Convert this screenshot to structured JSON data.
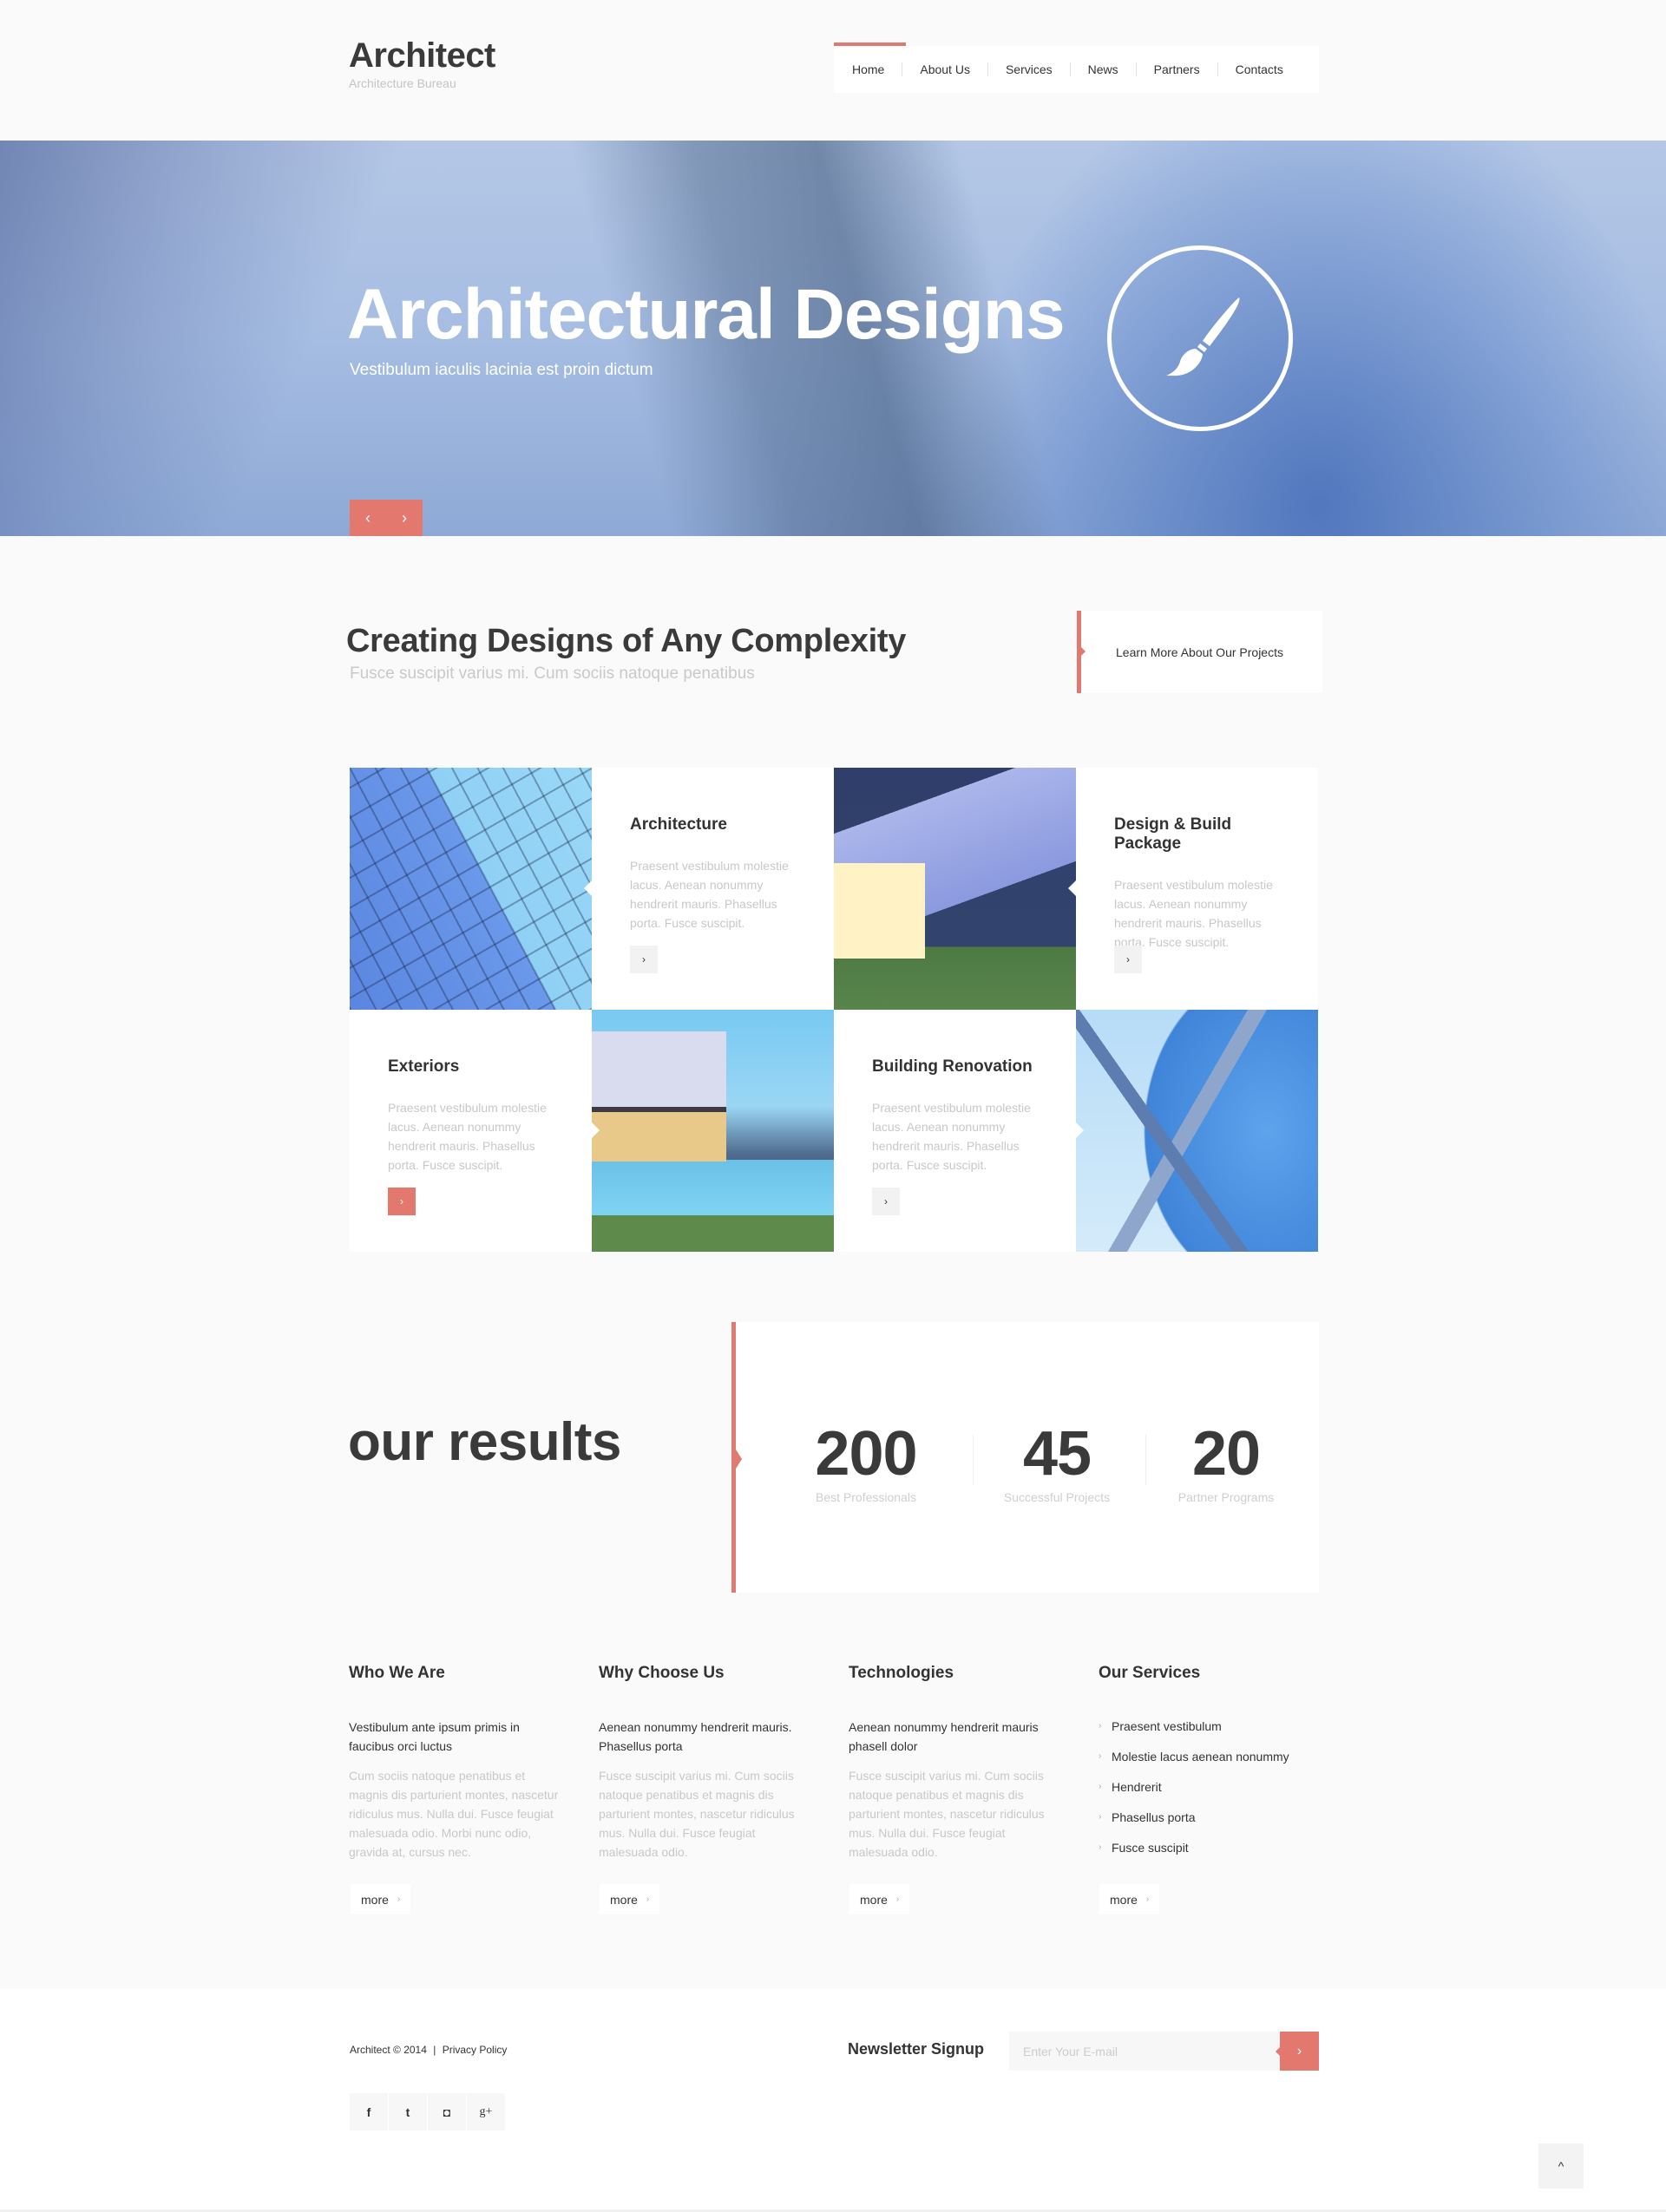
{
  "header": {
    "logo": "Architect",
    "tagline": "Architecture Bureau",
    "nav": [
      {
        "label": "Home",
        "active": true
      },
      {
        "label": "About Us"
      },
      {
        "label": "Services"
      },
      {
        "label": "News"
      },
      {
        "label": "Partners"
      },
      {
        "label": "Contacts"
      }
    ]
  },
  "hero": {
    "title": "Architectural Designs",
    "subtitle": "Vestibulum iaculis lacinia est proin dictum",
    "icon": "paintbrush-icon",
    "prev": "‹",
    "next": "›"
  },
  "intro": {
    "title": "Creating Designs of Any Complexity",
    "subtitle": "Fusce suscipit varius mi. Cum sociis natoque penatibus",
    "button": "Learn More About Our Projects"
  },
  "services_grid": [
    {
      "title": "Architecture",
      "text": "Praesent vestibulum molestie lacus. Aenean nonummy hendrerit mauris. Phasellus porta. Fusce suscipit.",
      "button": "›"
    },
    {
      "title": "Design & Build Package",
      "text": "Praesent vestibulum molestie lacus. Aenean nonummy hendrerit mauris. Phasellus porta. Fusce suscipit.",
      "button": "›"
    },
    {
      "title": "Exteriors",
      "text": "Praesent vestibulum molestie lacus. Aenean nonummy hendrerit mauris. Phasellus porta. Fusce suscipit.",
      "button": "›"
    },
    {
      "title": "Building Renovation",
      "text": "Praesent vestibulum molestie lacus. Aenean nonummy hendrerit mauris. Phasellus porta. Fusce suscipit.",
      "button": "›"
    }
  ],
  "results": {
    "title": "our results",
    "stats": [
      {
        "value": "200",
        "label": "Best Professionals"
      },
      {
        "value": "45",
        "label": "Successful Projects"
      },
      {
        "value": "20",
        "label": "Partner Programs"
      }
    ]
  },
  "info": {
    "more_label": "more",
    "more_chevron": "›",
    "who": {
      "title": "Who We Are",
      "lead": "Vestibulum ante ipsum primis in faucibus orci luctus",
      "body": "Cum sociis natoque penatibus et magnis dis parturient montes, nascetur ridiculus mus. Nulla dui. Fusce feugiat malesuada odio. Morbi nunc odio, gravida at, cursus nec."
    },
    "why": {
      "title": "Why Choose Us",
      "lead": "Aenean nonummy hendrerit mauris. Phasellus porta",
      "body": "Fusce suscipit varius mi. Cum sociis natoque penatibus et magnis dis parturient montes, nascetur ridiculus mus. Nulla dui. Fusce feugiat malesuada odio."
    },
    "tech": {
      "title": "Technologies",
      "lead": "Aenean nonummy hendrerit mauris phasell dolor",
      "body": "Fusce suscipit varius mi. Cum sociis natoque penatibus et magnis dis parturient montes, nascetur ridiculus mus. Nulla dui. Fusce feugiat malesuada odio."
    },
    "services": {
      "title": "Our Services",
      "items": [
        "Praesent vestibulum",
        "Molestie lacus aenean nonummy",
        "Hendrerit",
        "Phasellus porta",
        "Fusce suscipit"
      ]
    }
  },
  "footer": {
    "copyright": "Architect © 2014",
    "separator": "|",
    "privacy": "Privacy Policy",
    "newsletter_label": "Newsletter Signup",
    "email_placeholder": "Enter Your E-mail",
    "email_value": "",
    "submit": "›",
    "socials": [
      {
        "name": "facebook-icon",
        "glyph": "f"
      },
      {
        "name": "twitter-icon",
        "glyph": "t"
      },
      {
        "name": "instagram-icon",
        "glyph": "◘"
      },
      {
        "name": "google-plus-icon",
        "glyph": "g+"
      }
    ],
    "to_top": "^"
  },
  "colors": {
    "accent": "#e2786e",
    "text": "#3a3a3a",
    "muted": "#c8c8c8",
    "background": "#fafafa"
  }
}
